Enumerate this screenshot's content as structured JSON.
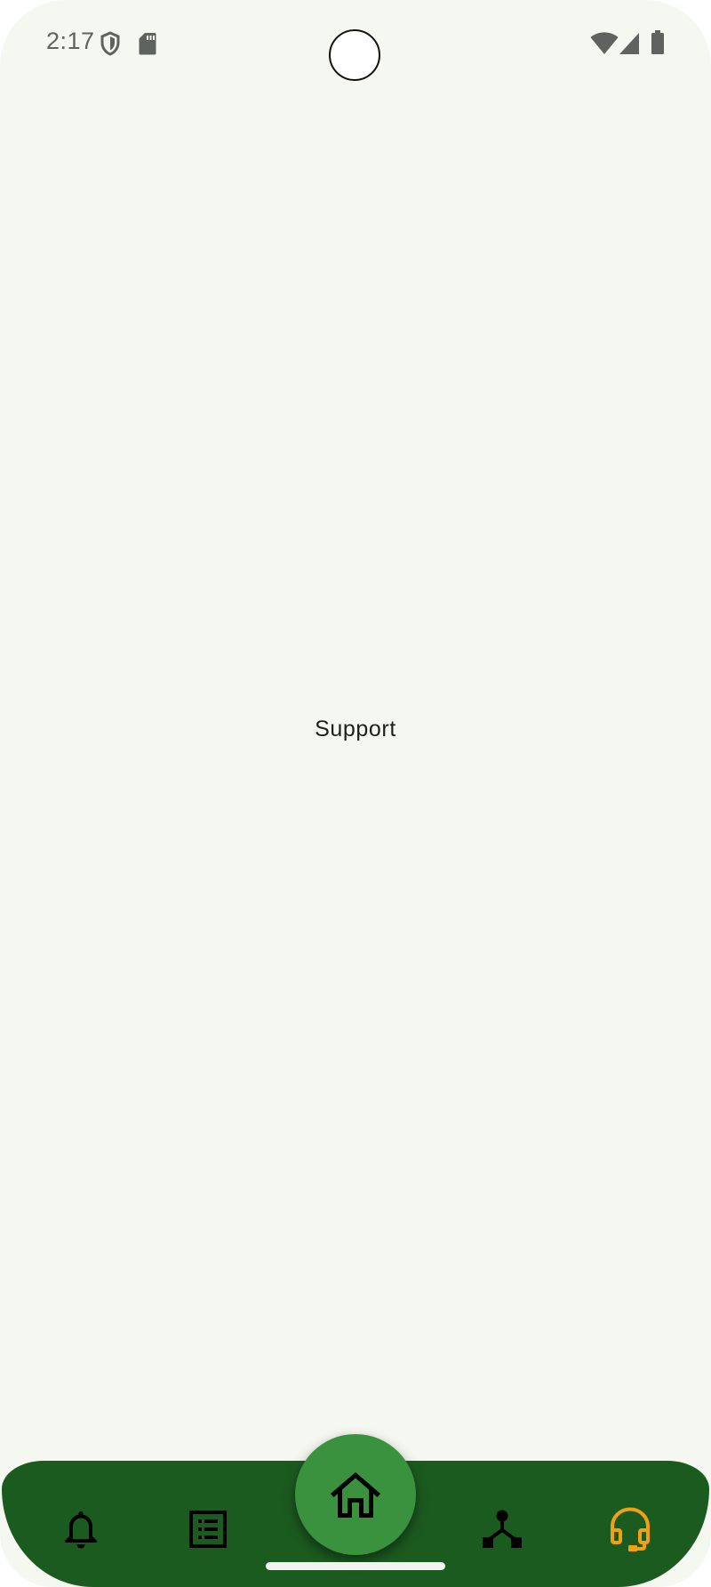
{
  "status_bar": {
    "time": "2:17",
    "icons": [
      "shield-icon",
      "sd-card-icon",
      "wifi-icon",
      "cell-signal-icon",
      "battery-icon"
    ]
  },
  "main": {
    "label": "Support"
  },
  "bottom_nav": {
    "items": [
      {
        "icon": "bell-icon",
        "active": false
      },
      {
        "icon": "list-icon",
        "active": false
      },
      {
        "icon": "home-icon",
        "active": false,
        "fab": true
      },
      {
        "icon": "network-icon",
        "active": false
      },
      {
        "icon": "headset-icon",
        "active": true
      }
    ],
    "colors": {
      "bar": "#1c5b20",
      "fab": "#3a923e",
      "active": "#f0a010",
      "inactive": "#000000"
    }
  },
  "colors": {
    "background": "#f5f8f0"
  }
}
